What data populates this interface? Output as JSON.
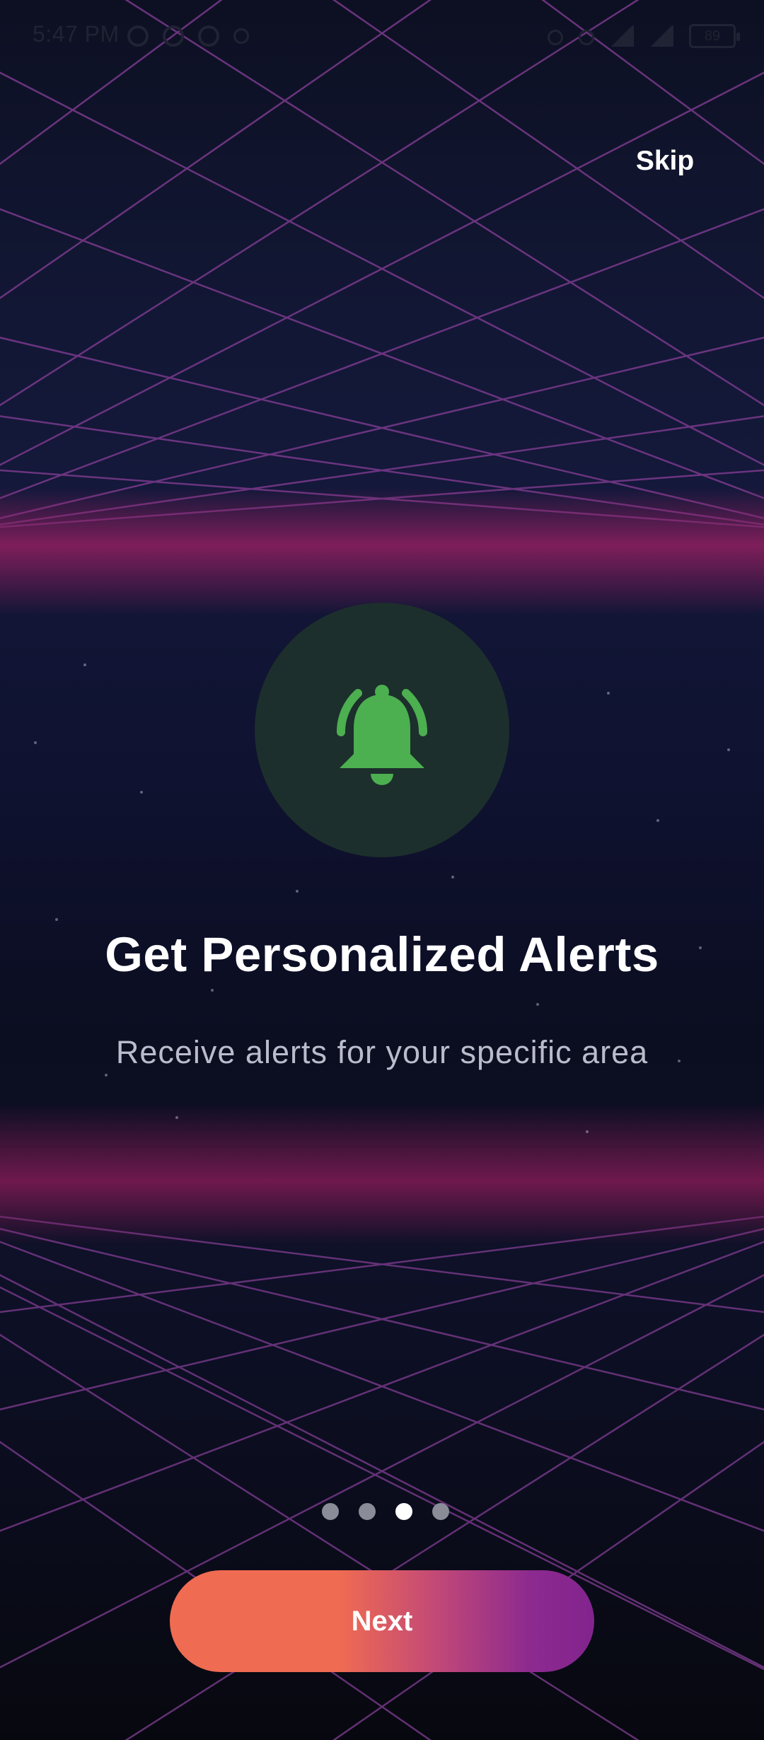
{
  "status_bar": {
    "time": "5:47 PM",
    "battery": "89",
    "icons": [
      "facebook-icon",
      "messenger-icon",
      "chat-icon",
      "dot-icon",
      "bluetooth-icon",
      "wifi-icon",
      "signal-icon",
      "battery-icon"
    ]
  },
  "header": {
    "skip_label": "Skip"
  },
  "feature": {
    "icon": "bell-ringing-icon",
    "title": "Get Personalized Alerts",
    "subtitle": "Receive alerts for your specific area"
  },
  "pager": {
    "total": 4,
    "active_index": 2
  },
  "footer": {
    "next_label": "Next"
  },
  "colors": {
    "accent_green": "#4caf50",
    "button_start": "#ef6b52",
    "button_end": "#82248e",
    "grid_line": "#7a3a8c",
    "horizon_glow": "#8a1f5e"
  }
}
